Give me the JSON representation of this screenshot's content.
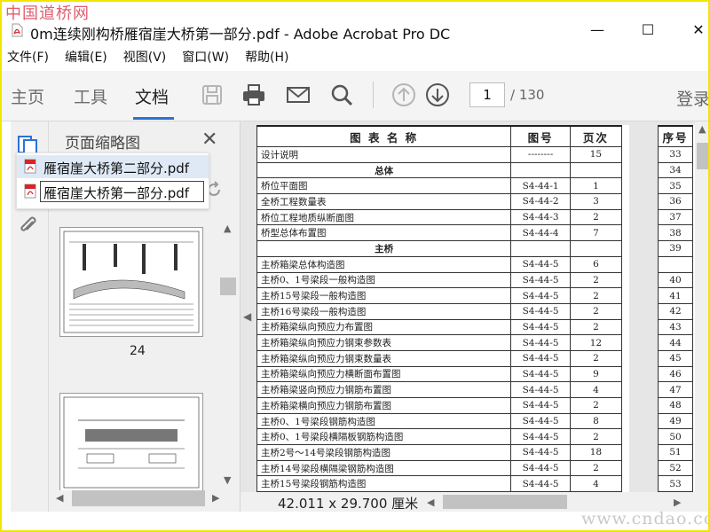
{
  "watermark_top": "中国道桥网",
  "watermark_bottom": "www.cndao.com",
  "window": {
    "title": "0m连续刚构桥雁宿崖大桥第一部分.pdf - Adobe Acrobat Pro DC",
    "minimize": "—",
    "maximize": "☐",
    "close": "✕"
  },
  "menu": [
    "文件(F)",
    "编辑(E)",
    "视图(V)",
    "窗口(W)",
    "帮助(H)"
  ],
  "toolbar": {
    "tab_home": "主页",
    "tab_tools": "工具",
    "tab_document": "文档",
    "page_current": "1",
    "page_total": "/ 130",
    "login": "登录"
  },
  "thumbnails": {
    "title": "页面缩略图",
    "page_a": "24",
    "page_b": ""
  },
  "popup": {
    "items": [
      "雁宿崖大桥第二部分.pdf",
      "雁宿崖大桥第一部分.pdf"
    ]
  },
  "document": {
    "headers": [
      "图 表 名 称",
      "图号",
      "页次",
      "序号"
    ],
    "rows": [
      {
        "name": "设计说明",
        "code": "--------",
        "pages": "15",
        "seq": "33"
      },
      {
        "name": "总体",
        "code": "",
        "pages": "",
        "seq": "34",
        "section": true
      },
      {
        "name": "桥位平面图",
        "code": "S4-44-1",
        "pages": "1",
        "seq": "35"
      },
      {
        "name": "全桥工程数量表",
        "code": "S4-44-2",
        "pages": "3",
        "seq": "36"
      },
      {
        "name": "桥位工程地质纵断面图",
        "code": "S4-44-3",
        "pages": "2",
        "seq": "37"
      },
      {
        "name": "桥型总体布置图",
        "code": "S4-44-4",
        "pages": "7",
        "seq": "38"
      },
      {
        "name": "主桥",
        "code": "",
        "pages": "",
        "seq": "39",
        "section": true
      },
      {
        "name": "主桥箱梁总体构造图",
        "code": "S4-44-5",
        "pages": "6",
        "seq": ""
      },
      {
        "name": "主桥0、1号梁段一般构造图",
        "code": "S4-44-5",
        "pages": "2",
        "seq": "40"
      },
      {
        "name": "主桥15号梁段一般构造图",
        "code": "S4-44-5",
        "pages": "2",
        "seq": "41"
      },
      {
        "name": "主桥16号梁段一般构造图",
        "code": "S4-44-5",
        "pages": "2",
        "seq": "42"
      },
      {
        "name": "主桥箱梁纵向预应力布置图",
        "code": "S4-44-5",
        "pages": "2",
        "seq": "43"
      },
      {
        "name": "主桥箱梁纵向预应力钢束参数表",
        "code": "S4-44-5",
        "pages": "12",
        "seq": "44"
      },
      {
        "name": "主桥箱梁纵向预应力钢束数量表",
        "code": "S4-44-5",
        "pages": "2",
        "seq": "45"
      },
      {
        "name": "主桥箱梁纵向预应力横断面布置图",
        "code": "S4-44-5",
        "pages": "9",
        "seq": "46"
      },
      {
        "name": "主桥箱梁竖向预应力钢筋布置图",
        "code": "S4-44-5",
        "pages": "4",
        "seq": "47"
      },
      {
        "name": "主桥箱梁横向预应力钢筋布置图",
        "code": "S4-44-5",
        "pages": "2",
        "seq": "48"
      },
      {
        "name": "主桥0、1号梁段钢筋构造图",
        "code": "S4-44-5",
        "pages": "8",
        "seq": "49"
      },
      {
        "name": "主桥0、1号梁段横隔板钢筋构造图",
        "code": "S4-44-5",
        "pages": "2",
        "seq": "50"
      },
      {
        "name": "主桥2号～14号梁段钢筋构造图",
        "code": "S4-44-5",
        "pages": "18",
        "seq": "51"
      },
      {
        "name": "主桥14号梁段横隔梁钢筋构造图",
        "code": "S4-44-5",
        "pages": "2",
        "seq": "52"
      },
      {
        "name": "主桥15号梁段钢筋构造图",
        "code": "S4-44-5",
        "pages": "4",
        "seq": "53"
      }
    ]
  },
  "status": {
    "page_size": "42.011 x 29.700 厘米"
  }
}
